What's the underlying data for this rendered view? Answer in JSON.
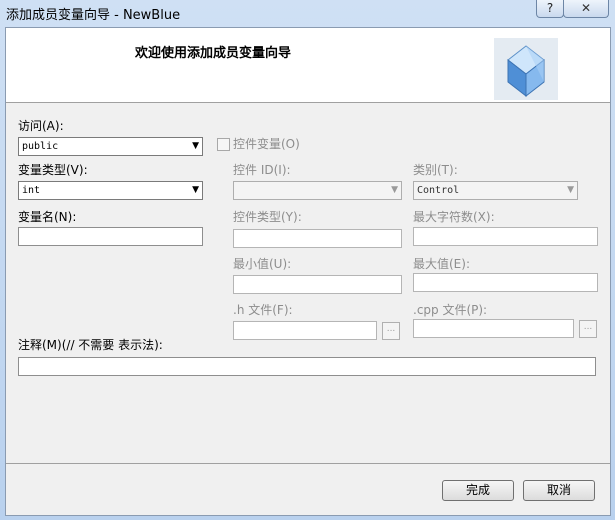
{
  "window": {
    "title": "添加成员变量向导 - NewBlue"
  },
  "titlebar_buttons": {
    "help": "?",
    "close": "✕"
  },
  "header": {
    "title": "欢迎使用添加成员变量向导",
    "icon": "cube-icon"
  },
  "form": {
    "access_label": "访问(A):",
    "access_value": "public",
    "control_var_label": "控件变量(O)",
    "control_var_checked": false,
    "var_type_label": "变量类型(V):",
    "var_type_value": "int",
    "control_id_label": "控件 ID(I):",
    "control_id_value": "",
    "category_label": "类别(T):",
    "category_value": "Control",
    "var_name_label": "变量名(N):",
    "var_name_value": "",
    "control_type_label": "控件类型(Y):",
    "max_chars_label": "最大字符数(X):",
    "min_value_label": "最小值(U):",
    "max_value_label": "最大值(E):",
    "h_file_label": ".h 文件(F):",
    "cpp_file_label": ".cpp 文件(P):",
    "browse_label": "...",
    "comment_label": "注释(M)(// 不需要 表示法):",
    "comment_value": ""
  },
  "buttons": {
    "finish": "完成",
    "cancel": "取消"
  },
  "colors": {
    "disabled_text": "#8d8d8d",
    "frame": "#b9d1ee"
  }
}
